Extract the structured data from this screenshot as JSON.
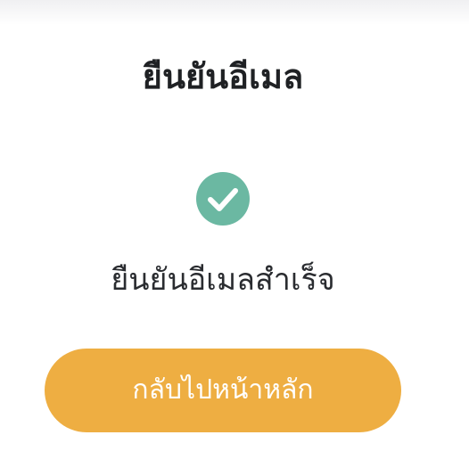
{
  "header": {
    "title": "ยืนยันอีเมล"
  },
  "status": {
    "icon": "check-circle-icon",
    "icon_color": "#6bb8a2",
    "message": "ยืนยันอีเมลสำเร็จ"
  },
  "actions": {
    "back_home_label": "กลับไปหน้าหลัก",
    "back_home_color": "#eeae42"
  }
}
